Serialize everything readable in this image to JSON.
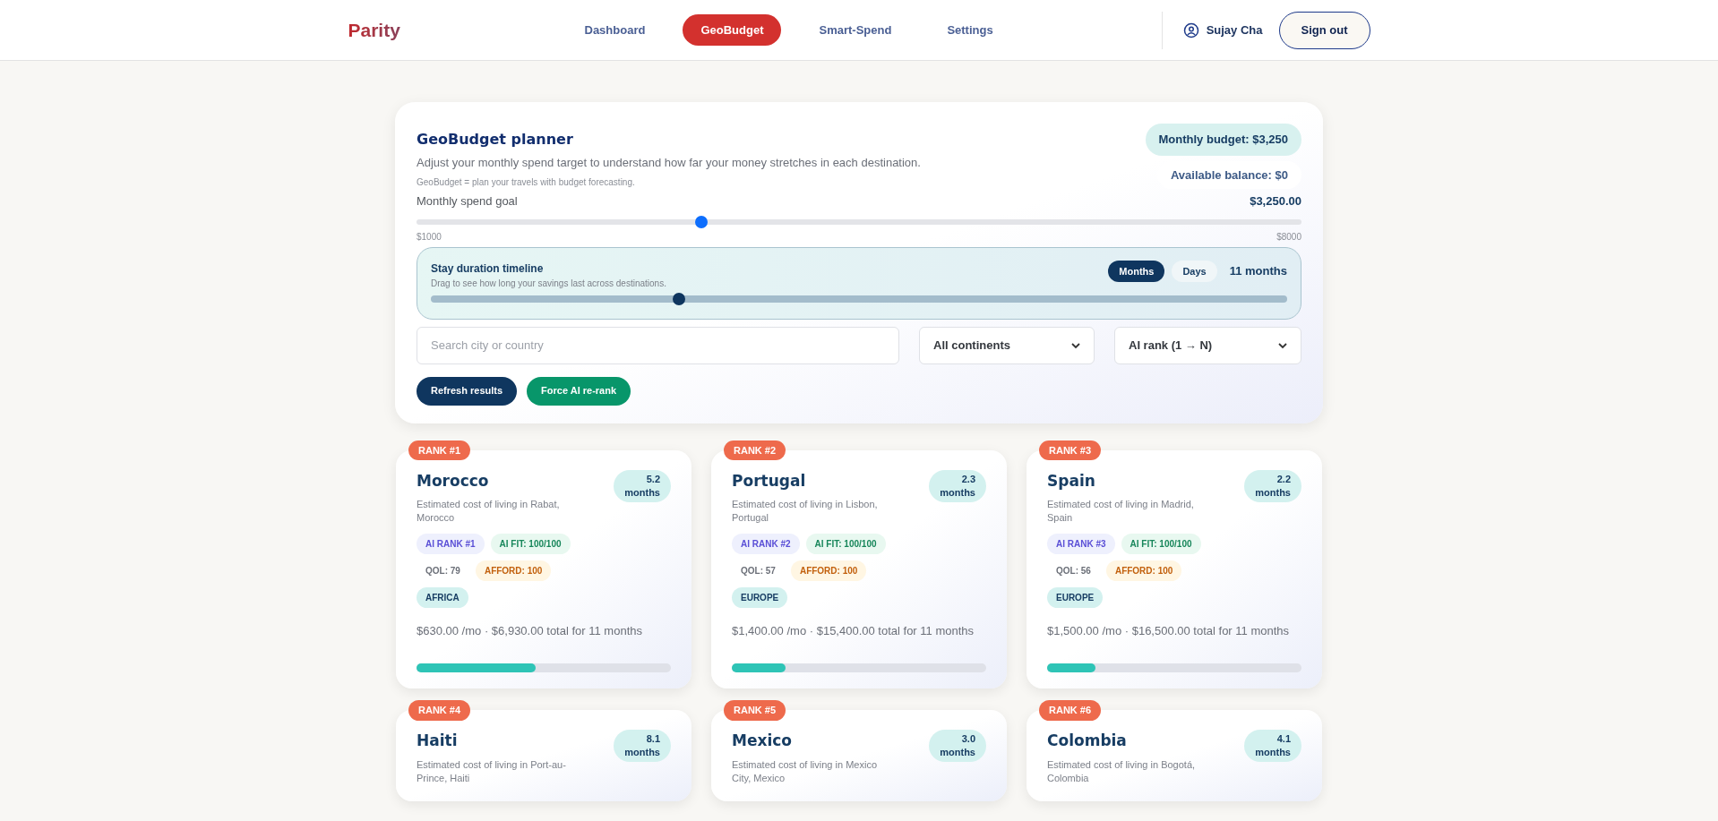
{
  "header": {
    "logo": "Parity",
    "nav": [
      {
        "label": "Dashboard",
        "selected": false
      },
      {
        "label": "GeoBudget",
        "selected": true
      },
      {
        "label": "Smart-Spend",
        "selected": false
      },
      {
        "label": "Settings",
        "selected": false
      }
    ],
    "user": "Sujay Cha",
    "sign_out": "Sign out"
  },
  "planner": {
    "title": "GeoBudget planner",
    "subtitle": "Adjust your monthly spend target to understand how far your money stretches in each destination.",
    "note": "GeoBudget = plan your travels with budget forecasting.",
    "monthly_budget": "Monthly budget: $3,250",
    "available_balance": "Available balance: $0",
    "spend_goal": {
      "label": "Monthly spend goal",
      "value": "$3,250.00",
      "level": 0.3214,
      "min": "$1000",
      "max": "$8000"
    },
    "timeline": {
      "title": "Stay duration timeline",
      "hint": "Drag to see how long your savings last across destinations.",
      "units": [
        {
          "label": "Months",
          "selected": true
        },
        {
          "label": "Days",
          "selected": false
        }
      ],
      "reading": "11 months",
      "level": 0.29
    },
    "search": {
      "placeholder": "Search city or country"
    },
    "continent_select": "All continents",
    "sort_select": "AI rank (1 → N)",
    "buttons": [
      {
        "label": "Refresh results",
        "kind": "primary"
      },
      {
        "label": "Force AI re-rank",
        "kind": "accent"
      }
    ]
  },
  "destinations": [
    {
      "rank": "RANK #1",
      "name": "Morocco",
      "months": "5.2",
      "months_unit": "months",
      "description": "Estimated cost of living in Rabat, Morocco",
      "ai_rank": "AI RANK #1",
      "ai_fit": "AI FIT: 100/100",
      "qol": "QOL: 79",
      "afford": "AFFORD: 100",
      "continent": "AFRICA",
      "cost": "$630.00 /mo · $6,930.00 total for 11 months",
      "level": 0.47
    },
    {
      "rank": "RANK #2",
      "name": "Portugal",
      "months": "2.3",
      "months_unit": "months",
      "description": "Estimated cost of living in Lisbon, Portugal",
      "ai_rank": "AI RANK #2",
      "ai_fit": "AI FIT: 100/100",
      "qol": "QOL: 57",
      "afford": "AFFORD: 100",
      "continent": "EUROPE",
      "cost": "$1,400.00 /mo · $15,400.00 total for 11 months",
      "level": 0.21
    },
    {
      "rank": "RANK #3",
      "name": "Spain",
      "months": "2.2",
      "months_unit": "months",
      "description": "Estimated cost of living in Madrid, Spain",
      "ai_rank": "AI RANK #3",
      "ai_fit": "AI FIT: 100/100",
      "qol": "QOL: 56",
      "afford": "AFFORD: 100",
      "continent": "EUROPE",
      "cost": "$1,500.00 /mo · $16,500.00 total for 11 months",
      "level": 0.19
    },
    {
      "rank": "RANK #4",
      "name": "Haiti",
      "months": "8.1",
      "months_unit": "months",
      "description": "Estimated cost of living in Port-au-Prince, Haiti"
    },
    {
      "rank": "RANK #5",
      "name": "Mexico",
      "months": "3.0",
      "months_unit": "months",
      "description": "Estimated cost of living in Mexico City, Mexico"
    },
    {
      "rank": "RANK #6",
      "name": "Colombia",
      "months": "4.1",
      "months_unit": "months",
      "description": "Estimated cost of living in Bogotá, Colombia"
    }
  ]
}
